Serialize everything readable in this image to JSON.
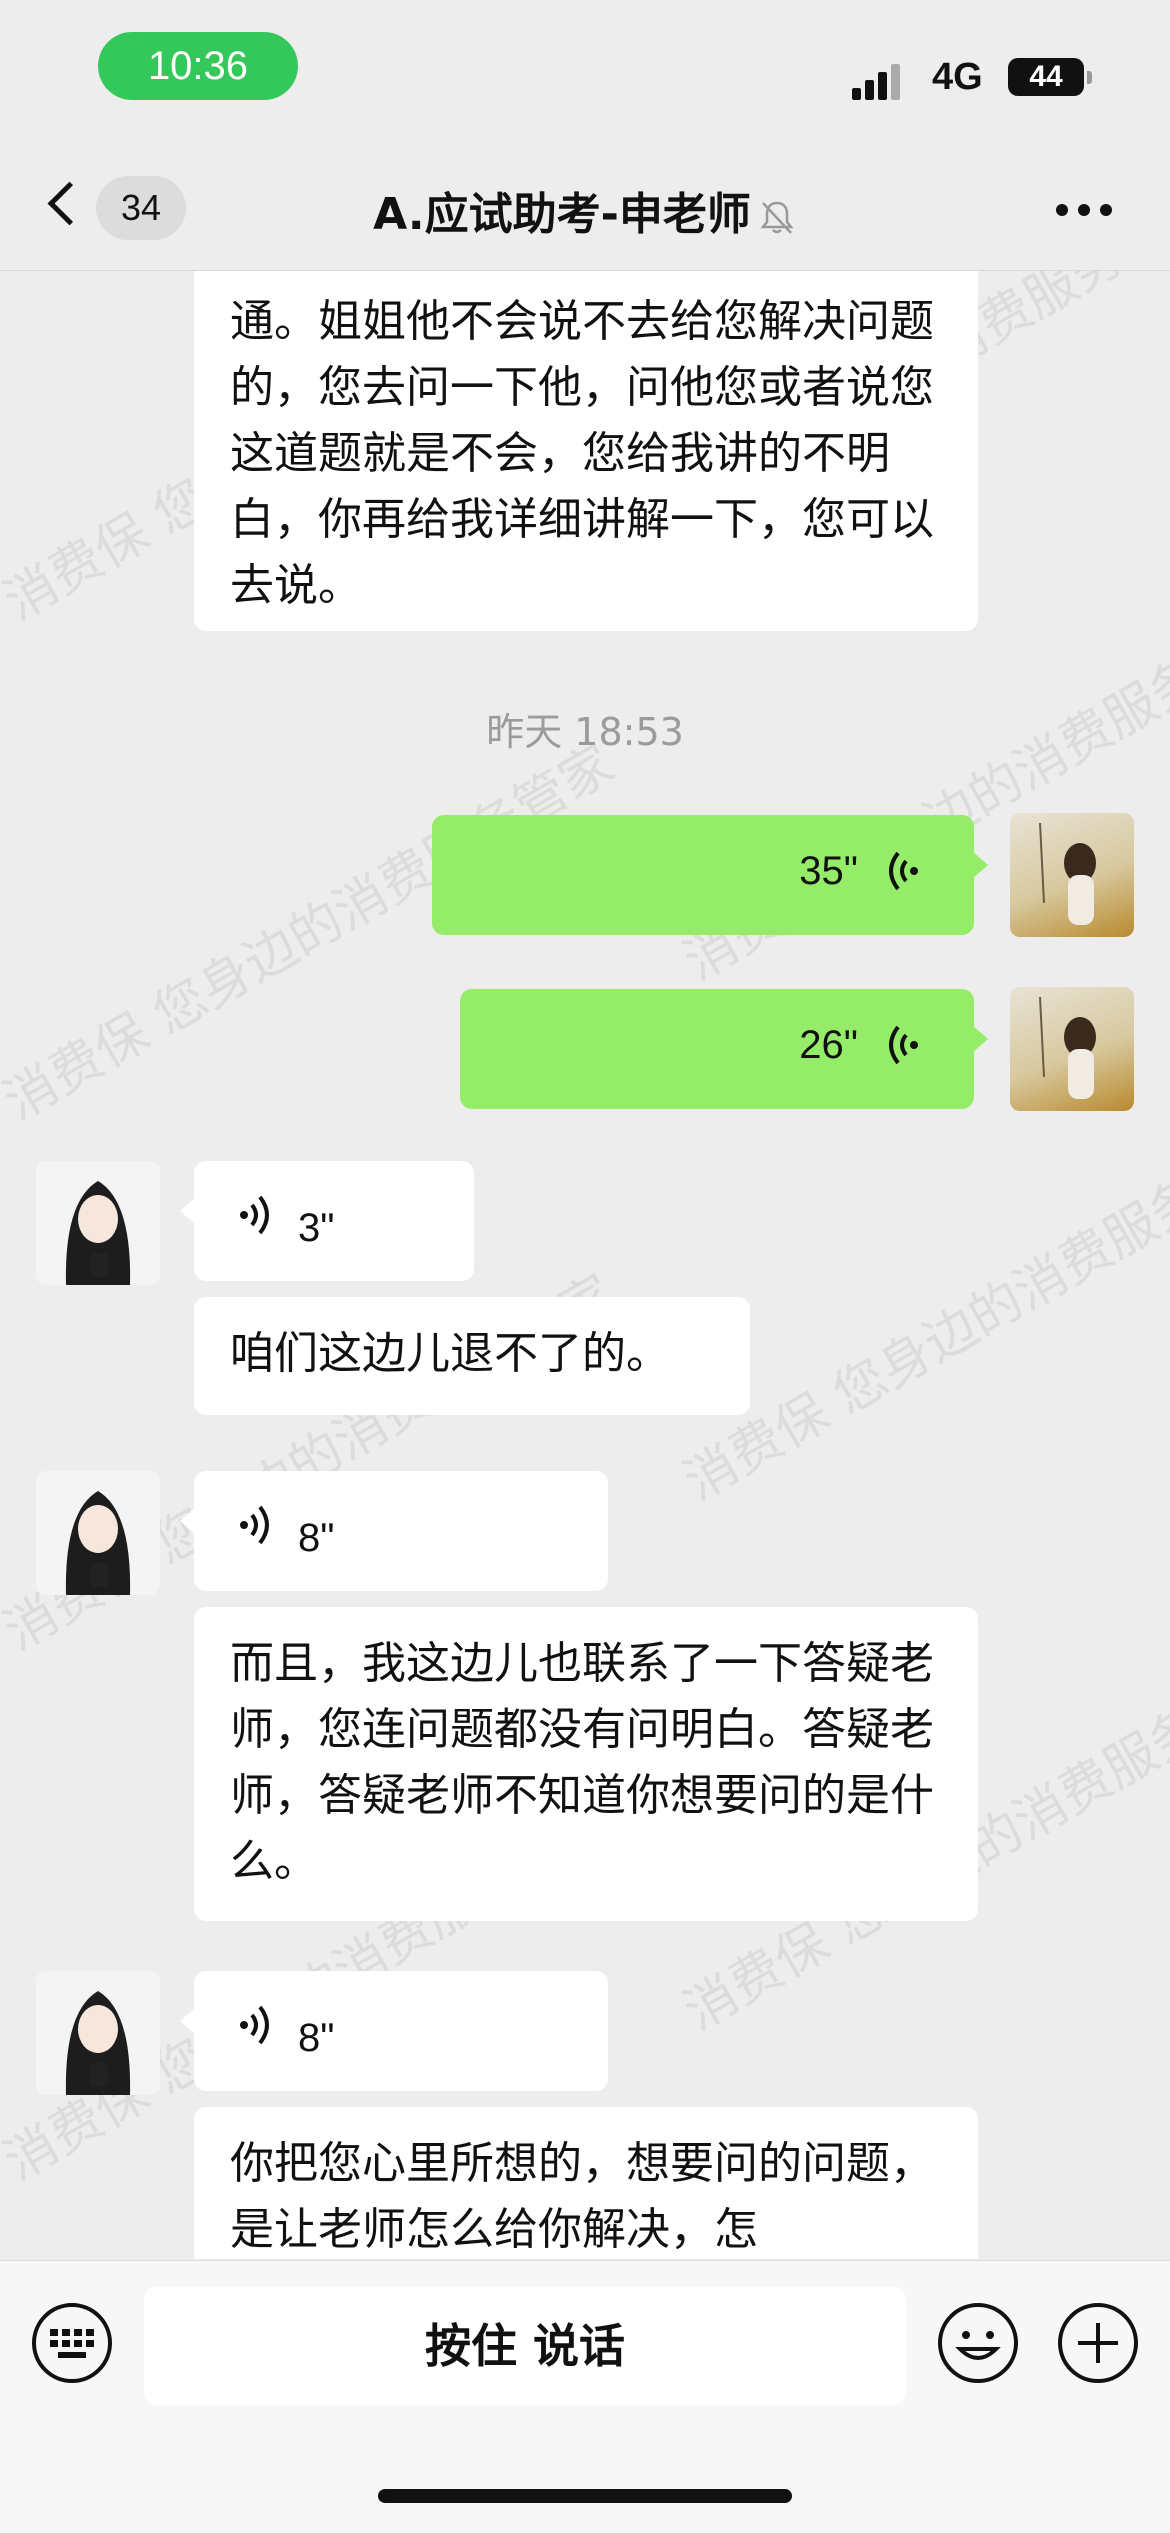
{
  "status_bar": {
    "time": "10:36",
    "network": "4G",
    "battery": "44"
  },
  "nav": {
    "unread_count": "34",
    "title": "A.应试助考-申老师"
  },
  "messages": {
    "m0": "通。姐姐他不会说不去给您解决问题的，您去问一下他，问他您或者说您这道题就是不会，您给我讲的不明白，你再给我详细讲解一下，您可以去说。",
    "timestamp": "昨天 18:53",
    "out_voice_1": "35\"",
    "out_voice_2": "26\"",
    "in_voice_1": "3\"",
    "m1": "咱们这边儿退不了的。",
    "in_voice_2": "8\"",
    "m2": "而且，我这边儿也联系了一下答疑老师，您连问题都没有问明白。答疑老师，答疑老师不知道你想要问的是什么。",
    "in_voice_3": "8\"",
    "m3": "你把您心里所想的，想要问的问题，是让老师怎么给你解决，怎"
  },
  "watermark": "消费保 您身边的消费服务管家",
  "bottom": {
    "hold_to_talk": "按住 说话"
  },
  "icons": [
    "back-icon",
    "bell-mute-icon",
    "more-icon",
    "voice-wave-icon",
    "keyboard-icon",
    "emoji-icon",
    "plus-icon",
    "signal-icon",
    "battery-icon"
  ],
  "colors": {
    "sent_bubble": "#95ec69",
    "time_pill": "#34c759",
    "background": "#ededed"
  }
}
